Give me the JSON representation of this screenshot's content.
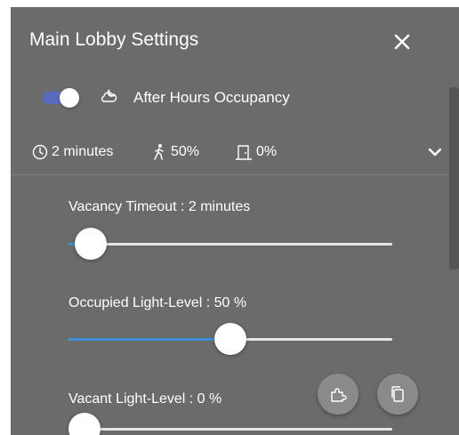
{
  "header": {
    "title": "Main Lobby Settings",
    "close_icon": "close-icon"
  },
  "scene": {
    "enabled": true,
    "name": "After Hours Occupancy",
    "icon": "cloud-moon-icon",
    "toggle_color": "#5c6bc0"
  },
  "summary": {
    "timeout": "2 minutes",
    "occupied_level": "50%",
    "vacant_level": "0%"
  },
  "settings": {
    "vacancy_timeout": {
      "label": "Vacancy Timeout : 2 minutes",
      "value_fraction": 0.07
    },
    "occupied_level": {
      "label": "Occupied Light-Level : 50 %",
      "value_fraction": 0.5
    },
    "vacant_level": {
      "label": "Vacant Light-Level : 0 %",
      "value_fraction": 0.0
    }
  },
  "colors": {
    "panel_bg": "#6b6b6b",
    "slider_fill": "#3d8fd6",
    "slider_track": "#e6e6e6"
  },
  "actions": {
    "apply_icon": "puzzle-icon",
    "copy_icon": "copy-icon"
  }
}
